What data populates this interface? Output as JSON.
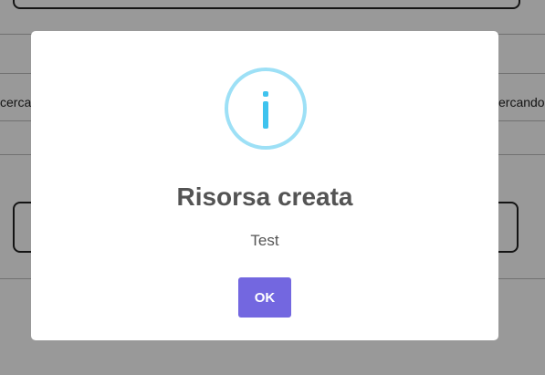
{
  "background": {
    "left_text": "cerca",
    "right_text": "ercando"
  },
  "modal": {
    "icon": "info-icon",
    "title": "Risorsa creata",
    "text": "Test",
    "ok_label": "OK"
  },
  "colors": {
    "overlay": "rgba(0,0,0,0.4)",
    "icon_ring": "#9de0f6",
    "icon_glyph": "#3fc3ee",
    "button": "#7367e0",
    "text": "#545454"
  }
}
